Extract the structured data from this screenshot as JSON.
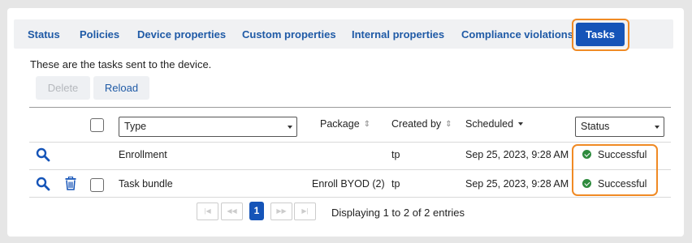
{
  "tabs": [
    {
      "label": "Status"
    },
    {
      "label": "Policies"
    },
    {
      "label": "Device properties"
    },
    {
      "label": "Custom properties"
    },
    {
      "label": "Internal properties"
    },
    {
      "label": "Compliance violations"
    },
    {
      "label": "Tasks",
      "active": true
    }
  ],
  "intro": "These are the tasks sent to the device.",
  "toolbar": {
    "delete_label": "Delete",
    "reload_label": "Reload"
  },
  "table": {
    "type_filter": "Type",
    "status_filter": "Status",
    "columns": {
      "package": "Package",
      "created_by": "Created by",
      "scheduled": "Scheduled"
    },
    "rows": [
      {
        "type": "Enrollment",
        "package": "",
        "created_by": "tp",
        "scheduled": "Sep 25, 2023, 9:28 AM",
        "status": "Successful"
      },
      {
        "type": "Task bundle",
        "package": "Enroll BYOD (2)",
        "created_by": "tp",
        "scheduled": "Sep 25, 2023, 9:28 AM",
        "status": "Successful"
      }
    ]
  },
  "pagination": {
    "current_page": "1",
    "info": "Displaying 1 to 2 of 2 entries"
  },
  "colors": {
    "accent": "#1554b8",
    "highlight": "#f08a24",
    "success": "#2e8b3d"
  },
  "icons": {
    "view": "search-icon",
    "delete": "trash-icon",
    "sort": "sort-icon",
    "status_ok": "check-circle-icon"
  }
}
